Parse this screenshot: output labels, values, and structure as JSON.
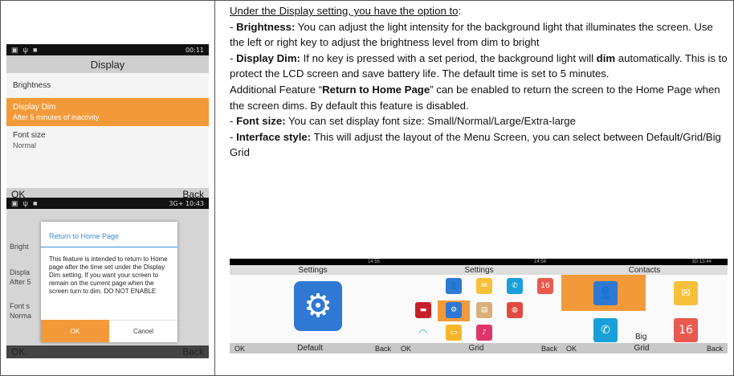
{
  "phone1": {
    "status_time": "00:11",
    "title": "Display",
    "items": [
      {
        "label": "Brightness",
        "sub": ""
      },
      {
        "label": "Display Dim",
        "sub": "After 5 minutes of inactivity"
      },
      {
        "label": "Font size",
        "sub": "Normal"
      }
    ],
    "softkey_left": "OK",
    "softkey_right": "Back"
  },
  "phone2": {
    "status_time": "3G+ 10:43",
    "bg_items": [
      "Bright",
      "Displa",
      "After 5",
      "Font s",
      "Norma"
    ],
    "dialog_title": "Return to Home Page",
    "dialog_body": "This feature is intended to return to Home page after the time set under the Display Dim setting. If you want your screen to remain on the current page when the screen turn to dim. DO NOT ENABLE",
    "dialog_ok": "OK",
    "dialog_cancel": "Cancel",
    "softkey_left": "OK",
    "softkey_right": "Back"
  },
  "text": {
    "intro": "Under the Display setting, you have the option to",
    "intro_colon": ":",
    "brightness_label": "Brightness:",
    "brightness_text": " You can adjust the light intensity for the background light that illuminates the screen. Use the left or right key to adjust the brightness level from dim to bright",
    "dim_label": "Display Dim:",
    "dim_text_1": " If no key is pressed with a set period, the background light will ",
    "dim_bold": "dim",
    "dim_text_2": " automatically. This is to protect the LCD screen and save battery life. The default time is set to 5 minutes.",
    "additional_1": "Additional Feature “",
    "additional_bold": "Return to Home Page",
    "additional_2": "” can be enabled to return the screen to the Home Page when the screen dims. By default this feature is disabled.",
    "font_label": "Font size:",
    "font_text": " You can set display font size: Small/Normal/Large/Extra-large",
    "interface_label": "Interface style:",
    "interface_text": " This will adjust the layout of the Menu Screen, you can select between Default/Grid/Big Grid",
    "bullet": "- "
  },
  "screens": [
    {
      "status": "14:55",
      "title": "Settings",
      "left": "OK",
      "mid": "Default",
      "right": "Back"
    },
    {
      "status": "14:54",
      "title": "Settings",
      "left": "OK",
      "mid": "Grid",
      "right": "Back"
    },
    {
      "status": "3G 13:44",
      "title": "Contacts",
      "left": "OK",
      "mid": "Grid",
      "mid_above": "Big",
      "right": "Back"
    }
  ],
  "tile_labels": {
    "sixteen": "16"
  },
  "colors": {
    "accent_orange": "#f29a3a",
    "dialog_blue": "#3c8fd0",
    "settings_blue": "#2f79d4"
  }
}
